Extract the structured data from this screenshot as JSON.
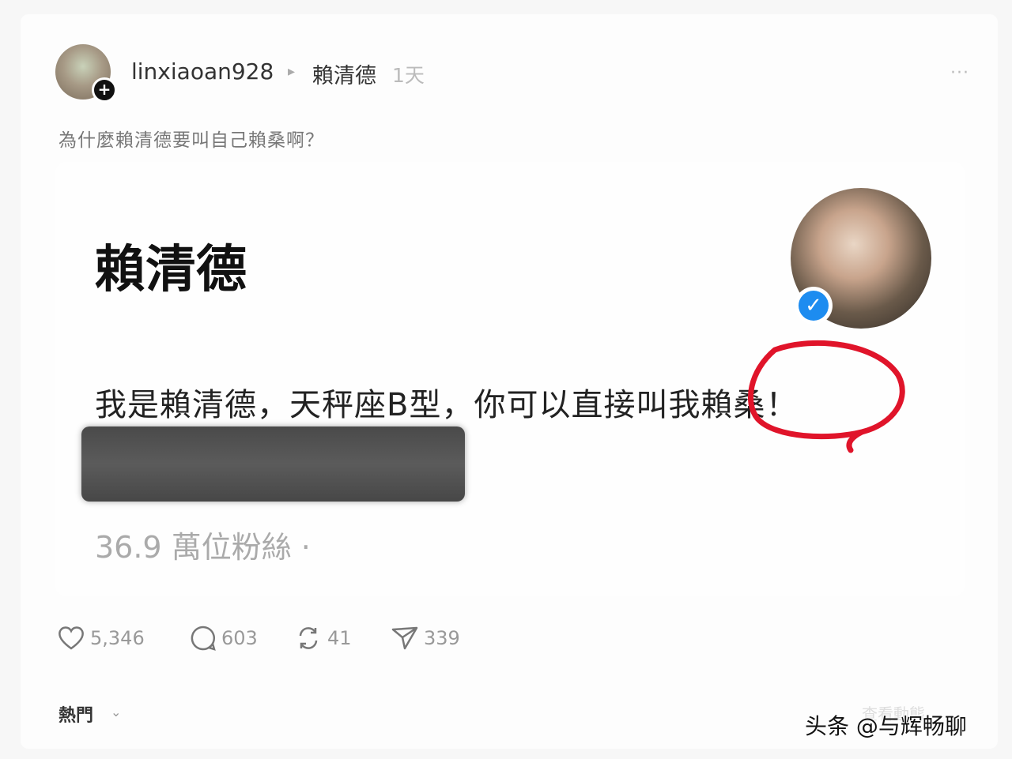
{
  "post": {
    "username": "linxiaoan928",
    "crumb_separator": "▸",
    "reply_to": "賴清德",
    "time": "1天",
    "more": "···",
    "caption": "為什麼賴清德要叫自己賴桑啊？"
  },
  "card": {
    "name": "賴清德",
    "bio": "我是賴清德，天秤座B型，你可以直接叫我賴桑！",
    "followers": "36.9 萬位粉絲 ·"
  },
  "actions": {
    "likes": "5,346",
    "comments": "603",
    "reposts": "41",
    "shares": "339"
  },
  "footer": {
    "sort_label": "熱門",
    "sort_chevron": "⌄",
    "right_faint": "查看動態",
    "watermark": "头条 @与辉畅聊"
  },
  "colors": {
    "annotation": "#e0142a",
    "verified": "#1d8cf0"
  },
  "icons": [
    "plus-icon",
    "heart-icon",
    "comment-icon",
    "repost-icon",
    "share-icon",
    "verified-icon",
    "more-icon",
    "chevron-down-icon"
  ]
}
